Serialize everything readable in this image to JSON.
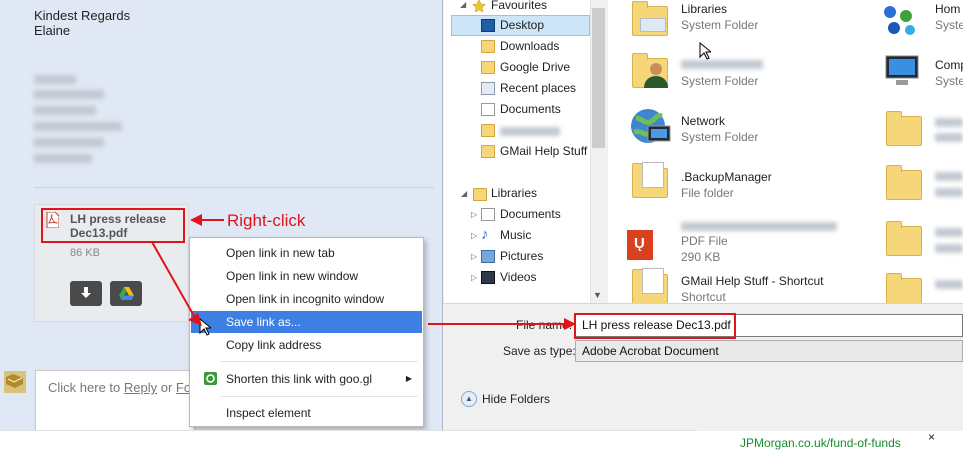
{
  "email": {
    "closing": "Kindest Regards",
    "sender": "Elaine",
    "attachment": {
      "name_line1": "LH press release",
      "name_line2": "Dec13.pdf",
      "size": "86 KB",
      "download_icon": "download-arrow-icon",
      "drive_icon": "google-drive-icon"
    },
    "annotation": "Right-click",
    "reply": {
      "prefix": "Click here to ",
      "reply_link": "Reply",
      "middle": " or ",
      "forward_partial": "Fo"
    }
  },
  "context_menu": {
    "items": [
      "Open link in new tab",
      "Open link in new window",
      "Open link in incognito window",
      "Save link as...",
      "Copy link address",
      "Shorten this link with goo.gl",
      "Inspect element"
    ],
    "highlighted_index": 3,
    "submenu_arrow": "▶"
  },
  "save_dialog": {
    "nav": {
      "favourites_label": "Favourites",
      "favourites": [
        "Desktop",
        "Downloads",
        "Google Drive",
        "Recent places",
        "Documents",
        "GMail Help Stuff"
      ],
      "libraries_label": "Libraries",
      "libraries": [
        "Documents",
        "Music",
        "Pictures",
        "Videos"
      ]
    },
    "files": [
      {
        "name": "Libraries",
        "sub": "System Folder"
      },
      {
        "name": "",
        "sub": "System Folder"
      },
      {
        "name": "Network",
        "sub": "System Folder"
      },
      {
        "name": ".BackupManager",
        "sub": "File folder"
      },
      {
        "name": "",
        "sub": "PDF File",
        "size": "290 KB"
      },
      {
        "name": "GMail Help Stuff - Shortcut",
        "sub": "Shortcut"
      }
    ],
    "files_col2": [
      {
        "name": "Hom",
        "sub": "Syste"
      },
      {
        "name": "Comp",
        "sub": "Syste"
      }
    ],
    "file_name_label": "File name:",
    "file_name_value": "LH press release Dec13.pdf",
    "save_as_type_label": "Save as type:",
    "save_as_type_value": "Adobe Acrobat Document",
    "hide_folders": "Hide Folders"
  },
  "ad": {
    "link": "JPMorgan.co.uk/fund-of-funds",
    "close": "×"
  },
  "colors": {
    "annotation_red": "#e1131b",
    "menu_highlight": "#3d7fe3",
    "nav_selected": "#cde6f7",
    "link_green": "#1a8a2e"
  }
}
